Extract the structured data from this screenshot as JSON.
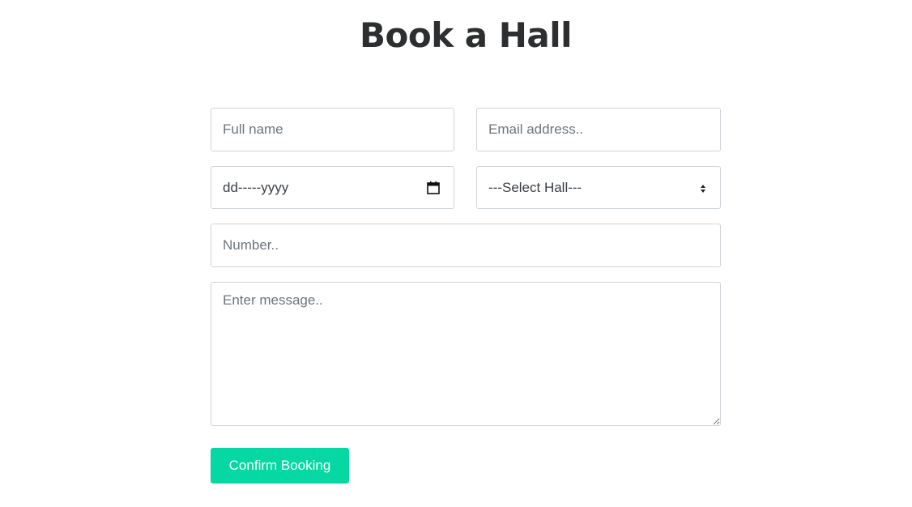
{
  "page": {
    "title": "Book a Hall"
  },
  "form": {
    "fullname_placeholder": "Full name",
    "email_placeholder": "Email address..",
    "date_value": "dd-----yyyy",
    "hall_select_value": "---Select Hall---",
    "number_placeholder": "Number..",
    "message_placeholder": "Enter message..",
    "submit_label": "Confirm Booking"
  },
  "icons": {
    "date": "calendar-icon",
    "select": "up-down-arrows-icon"
  },
  "colors": {
    "accent": "#05d8a2",
    "title": "#2c2e2f",
    "border": "#cfd4d9"
  }
}
